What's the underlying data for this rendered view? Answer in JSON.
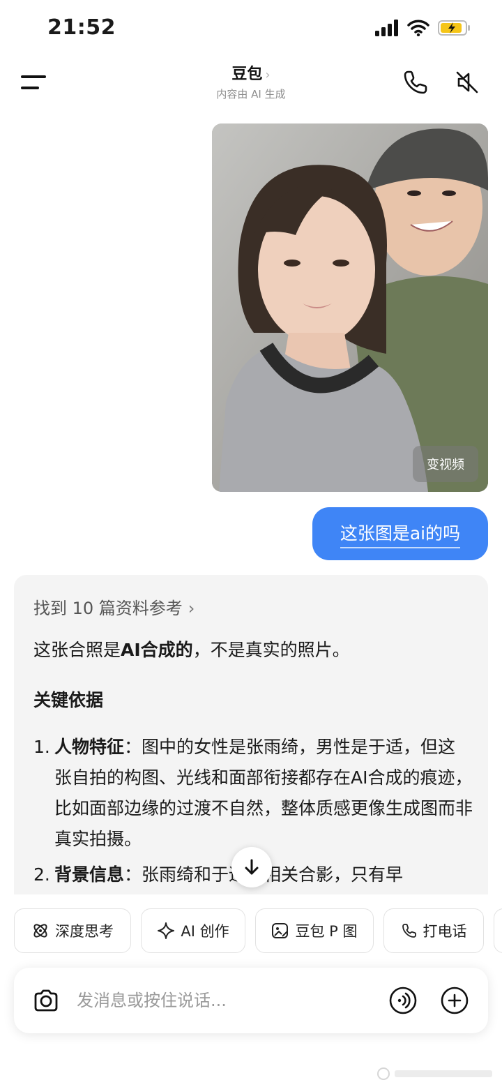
{
  "status": {
    "time": "21:52"
  },
  "nav": {
    "title": "豆包",
    "chevron": "›",
    "subtitle": "内容由 AI 生成"
  },
  "photo": {
    "button_label": "变视频"
  },
  "user_message": "这张图是ai的吗",
  "bot": {
    "refs_label": "找到 10 篇资料参考",
    "refs_chevron": "›",
    "line1_pre": "这张合照是",
    "line1_bold": "AI合成的",
    "line1_post": "，不是真实的照片。",
    "heading": "关键依据",
    "items": [
      {
        "num": "1.",
        "title": "人物特征",
        "text": "：图中的女性是张雨绮，男性是于适，但这张自拍的构图、光线和面部衔接都存在AI合成的痕迹，比如面部边缘的过渡不自然，整体质感更像生成图而非真实拍摄。"
      },
      {
        "num": "2.",
        "title": "背景信息",
        "text": "：张雨绮和于适的相关合影，只有早"
      }
    ]
  },
  "chips": [
    {
      "label": "深度思考",
      "icon": "atom-icon"
    },
    {
      "label": "AI 创作",
      "icon": "sparkle-icon"
    },
    {
      "label": "豆包 P 图",
      "icon": "image-edit-icon"
    },
    {
      "label": "打电话",
      "icon": "phone-icon"
    }
  ],
  "input": {
    "placeholder": "发消息或按住说话..."
  },
  "colors": {
    "accent": "#3f85f6",
    "card_bg": "#f4f4f4",
    "battery": "#f5c518"
  }
}
